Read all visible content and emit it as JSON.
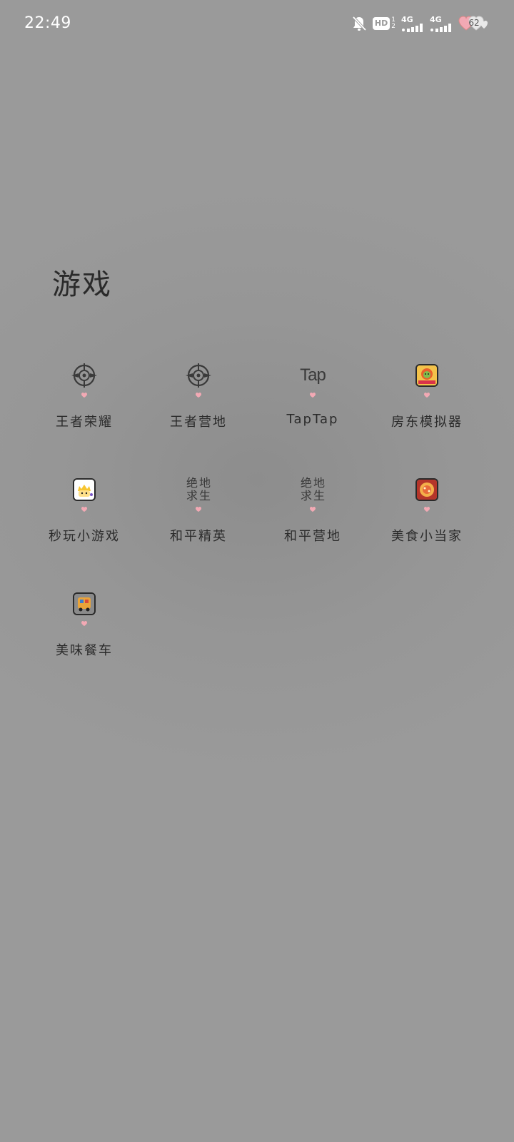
{
  "status_bar": {
    "time": "22:49",
    "hd_label": "HD",
    "hd_sub_top": "1",
    "hd_sub_bottom": "2",
    "signal_1_label": "4G",
    "signal_2_label": "4G",
    "battery_level": "62",
    "icons": [
      "bell-off-icon",
      "hd-icon",
      "signal-icon",
      "signal-icon",
      "battery-heart-icon"
    ]
  },
  "folder": {
    "title": "游戏"
  },
  "apps": [
    {
      "label": "王者荣耀",
      "icon": "crosshair-logo-icon"
    },
    {
      "label": "王者营地",
      "icon": "crosshair-logo-icon"
    },
    {
      "label": "TapTap",
      "icon_text": "Tap"
    },
    {
      "label": "房东模拟器",
      "icon": "landlord-game-thumbnail"
    },
    {
      "label": "秒玩小游戏",
      "icon": "mini-game-thumbnail"
    },
    {
      "label": "和平精英",
      "icon_chars": [
        "绝",
        "地",
        "求",
        "生"
      ]
    },
    {
      "label": "和平营地",
      "icon_chars": [
        "绝",
        "地",
        "求",
        "生"
      ]
    },
    {
      "label": "美食小当家",
      "icon": "food-game-thumbnail"
    },
    {
      "label": "美味餐车",
      "icon": "food-truck-thumbnail"
    }
  ],
  "colors": {
    "background": "#9a9a9a",
    "label_text": "#2b2b2b",
    "heart_dot": "#f2a9b4"
  }
}
